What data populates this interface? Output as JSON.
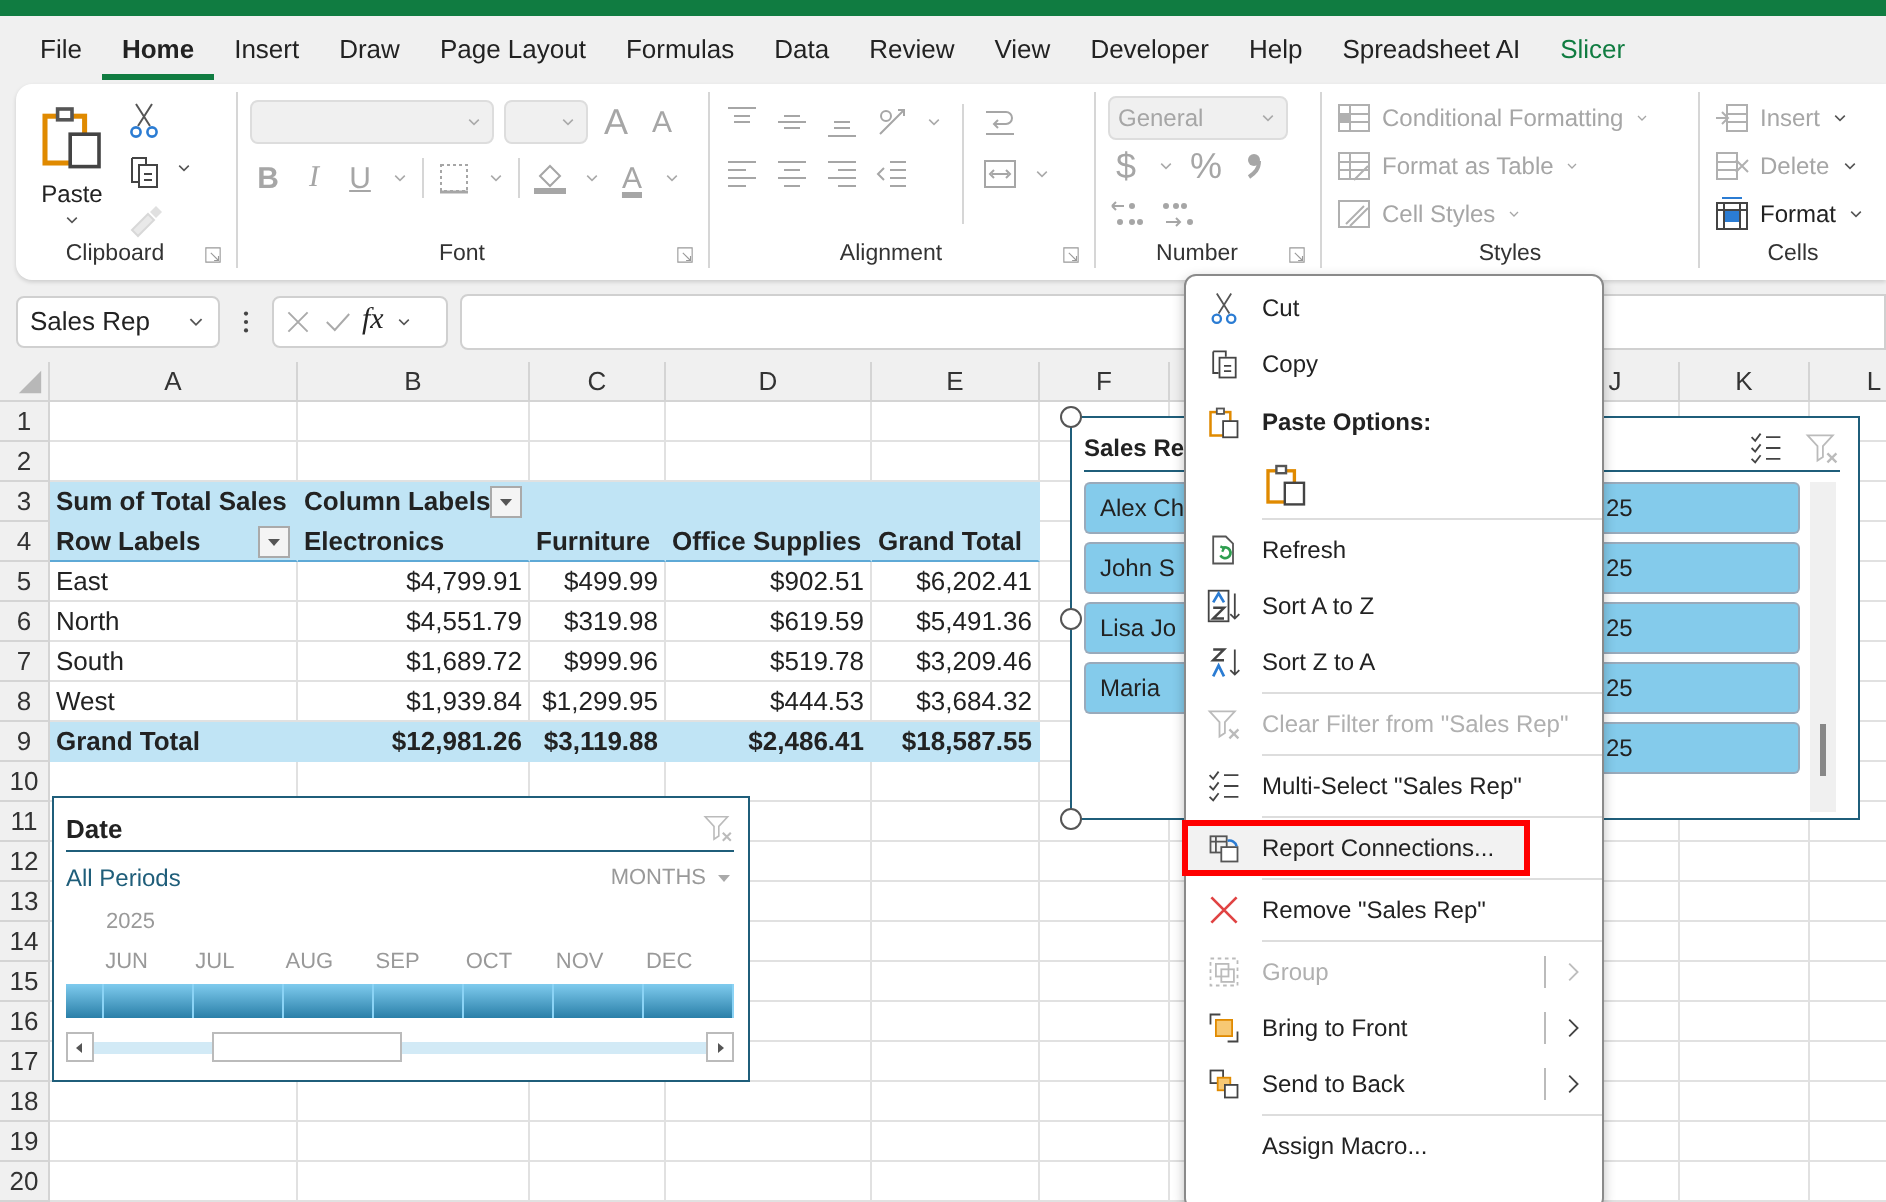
{
  "tabs": [
    {
      "label": "File",
      "selected": false,
      "contextual": false
    },
    {
      "label": "Home",
      "selected": true,
      "contextual": false
    },
    {
      "label": "Insert",
      "selected": false,
      "contextual": false
    },
    {
      "label": "Draw",
      "selected": false,
      "contextual": false
    },
    {
      "label": "Page Layout",
      "selected": false,
      "contextual": false
    },
    {
      "label": "Formulas",
      "selected": false,
      "contextual": false
    },
    {
      "label": "Data",
      "selected": false,
      "contextual": false
    },
    {
      "label": "Review",
      "selected": false,
      "contextual": false
    },
    {
      "label": "View",
      "selected": false,
      "contextual": false
    },
    {
      "label": "Developer",
      "selected": false,
      "contextual": false
    },
    {
      "label": "Help",
      "selected": false,
      "contextual": false
    },
    {
      "label": "Spreadsheet AI",
      "selected": false,
      "contextual": false
    },
    {
      "label": "Slicer",
      "selected": false,
      "contextual": true
    }
  ],
  "ribbon": {
    "clipboard": {
      "label": "Clipboard",
      "paste": "Paste",
      "tools": [
        {
          "disabled": false
        },
        {
          "disabled": false
        },
        {
          "disabled": true
        }
      ]
    },
    "font": {
      "label": "Font",
      "disabled": true,
      "grow": "A",
      "shrink": "A",
      "bold": "B",
      "italic": "I",
      "underline": "U",
      "color_letter": "A"
    },
    "alignment": {
      "label": "Alignment",
      "disabled": true
    },
    "number": {
      "label": "Number",
      "disabled": true,
      "format": "General",
      "currency": "$",
      "percent": "%"
    },
    "styles": {
      "label": "Styles",
      "commands": [
        {
          "label": "Conditional Formatting",
          "disabled": true
        },
        {
          "label": "Format as Table",
          "disabled": true
        },
        {
          "label": "Cell Styles",
          "disabled": true
        }
      ]
    },
    "cells": {
      "label": "Cells",
      "commands": [
        {
          "label": "Insert",
          "disabled": true
        },
        {
          "label": "Delete",
          "disabled": true
        },
        {
          "label": "Format",
          "disabled": false
        }
      ]
    }
  },
  "formula_bar": {
    "name_box": "Sales Rep",
    "fx": "fx"
  },
  "sheet": {
    "columns": [
      "A",
      "B",
      "C",
      "D",
      "E",
      "F"
    ],
    "columns_right": [
      "J",
      "K",
      "L"
    ],
    "rows": [
      {
        "number": "1",
        "kind": "blank"
      },
      {
        "number": "2",
        "kind": "blank"
      },
      {
        "number": "3",
        "kind": "title",
        "cells": [
          {
            "text": "Sum of Total Sales",
            "filter": false
          },
          {
            "text": "Column Labels",
            "filter": true
          }
        ]
      },
      {
        "number": "4",
        "kind": "header",
        "cells": [
          {
            "text": "Row Labels",
            "filter": true
          },
          {
            "text": "Electronics",
            "filter": false
          },
          {
            "text": "Furniture",
            "filter": false
          },
          {
            "text": "Office Supplies",
            "filter": false
          },
          {
            "text": "Grand Total",
            "filter": false
          }
        ]
      },
      {
        "number": "5",
        "kind": "data",
        "cells": [
          "East",
          "$4,799.91",
          "$499.99",
          "$902.51",
          "$6,202.41"
        ]
      },
      {
        "number": "6",
        "kind": "data",
        "cells": [
          "North",
          "$4,551.79",
          "$319.98",
          "$619.59",
          "$5,491.36"
        ]
      },
      {
        "number": "7",
        "kind": "data",
        "cells": [
          "South",
          "$1,689.72",
          "$999.96",
          "$519.78",
          "$3,209.46"
        ]
      },
      {
        "number": "8",
        "kind": "data",
        "cells": [
          "West",
          "$1,939.84",
          "$1,299.95",
          "$444.53",
          "$3,684.32"
        ]
      },
      {
        "number": "9",
        "kind": "total",
        "cells": [
          "Grand Total",
          "$12,981.26",
          "$3,119.88",
          "$2,486.41",
          "$18,587.55"
        ]
      },
      {
        "number": "10",
        "kind": "blank"
      },
      {
        "number": "11",
        "kind": "blank"
      },
      {
        "number": "12",
        "kind": "blank"
      },
      {
        "number": "13",
        "kind": "blank"
      },
      {
        "number": "14",
        "kind": "blank"
      },
      {
        "number": "15",
        "kind": "blank"
      },
      {
        "number": "16",
        "kind": "blank"
      },
      {
        "number": "17",
        "kind": "blank"
      },
      {
        "number": "18",
        "kind": "blank"
      },
      {
        "number": "19",
        "kind": "blank"
      },
      {
        "number": "20",
        "kind": "blank"
      }
    ]
  },
  "timeline": {
    "title": "Date",
    "period": "All Periods",
    "time_level": "MONTHS",
    "year": "2025",
    "months": [
      "JUN",
      "JUL",
      "AUG",
      "SEP",
      "OCT",
      "NOV",
      "DEC"
    ]
  },
  "slicer": {
    "title": "Sales Re",
    "items_left": [
      {
        "label": "Alex Ch",
        "selected": true
      },
      {
        "label": "John S",
        "selected": true
      },
      {
        "label": "Lisa Jo",
        "selected": true
      },
      {
        "label": "Maria",
        "selected": true
      }
    ],
    "items_right": [
      {
        "label": "25",
        "selected": true
      },
      {
        "label": "25",
        "selected": true
      },
      {
        "label": "25",
        "selected": true
      },
      {
        "label": "25",
        "selected": true
      },
      {
        "label": "25",
        "selected": true
      }
    ]
  },
  "context_menu": {
    "items": [
      {
        "kind": "item",
        "label": "Cut",
        "disabled": false,
        "submenu": false,
        "highlighted": false
      },
      {
        "kind": "item",
        "label": "Copy",
        "disabled": false,
        "submenu": false,
        "highlighted": false
      },
      {
        "kind": "heading",
        "label": "Paste Options:"
      },
      {
        "kind": "paste_row"
      },
      {
        "kind": "separator"
      },
      {
        "kind": "item",
        "label": "Refresh",
        "disabled": false,
        "submenu": false,
        "highlighted": false
      },
      {
        "kind": "item",
        "label": "Sort A to Z",
        "disabled": false,
        "submenu": false,
        "highlighted": false
      },
      {
        "kind": "item",
        "label": "Sort Z to A",
        "disabled": false,
        "submenu": false,
        "highlighted": false
      },
      {
        "kind": "separator"
      },
      {
        "kind": "item",
        "label": "Clear Filter from \"Sales Rep\"",
        "disabled": true,
        "submenu": false,
        "highlighted": false
      },
      {
        "kind": "separator"
      },
      {
        "kind": "item",
        "label": "Multi-Select \"Sales Rep\"",
        "disabled": false,
        "submenu": false,
        "highlighted": false
      },
      {
        "kind": "separator"
      },
      {
        "kind": "item",
        "label": "Report Connections...",
        "disabled": false,
        "submenu": false,
        "highlighted": true
      },
      {
        "kind": "separator"
      },
      {
        "kind": "item",
        "label": "Remove \"Sales Rep\"",
        "disabled": false,
        "submenu": false,
        "highlighted": false
      },
      {
        "kind": "separator"
      },
      {
        "kind": "item",
        "label": "Group",
        "disabled": true,
        "submenu": true,
        "highlighted": false
      },
      {
        "kind": "item",
        "label": "Bring to Front",
        "disabled": false,
        "submenu": true,
        "highlighted": false
      },
      {
        "kind": "item",
        "label": "Send to Back",
        "disabled": false,
        "submenu": true,
        "highlighted": false
      },
      {
        "kind": "separator"
      },
      {
        "kind": "item",
        "label": "Assign Macro...",
        "disabled": false,
        "submenu": false,
        "highlighted": false
      }
    ]
  }
}
